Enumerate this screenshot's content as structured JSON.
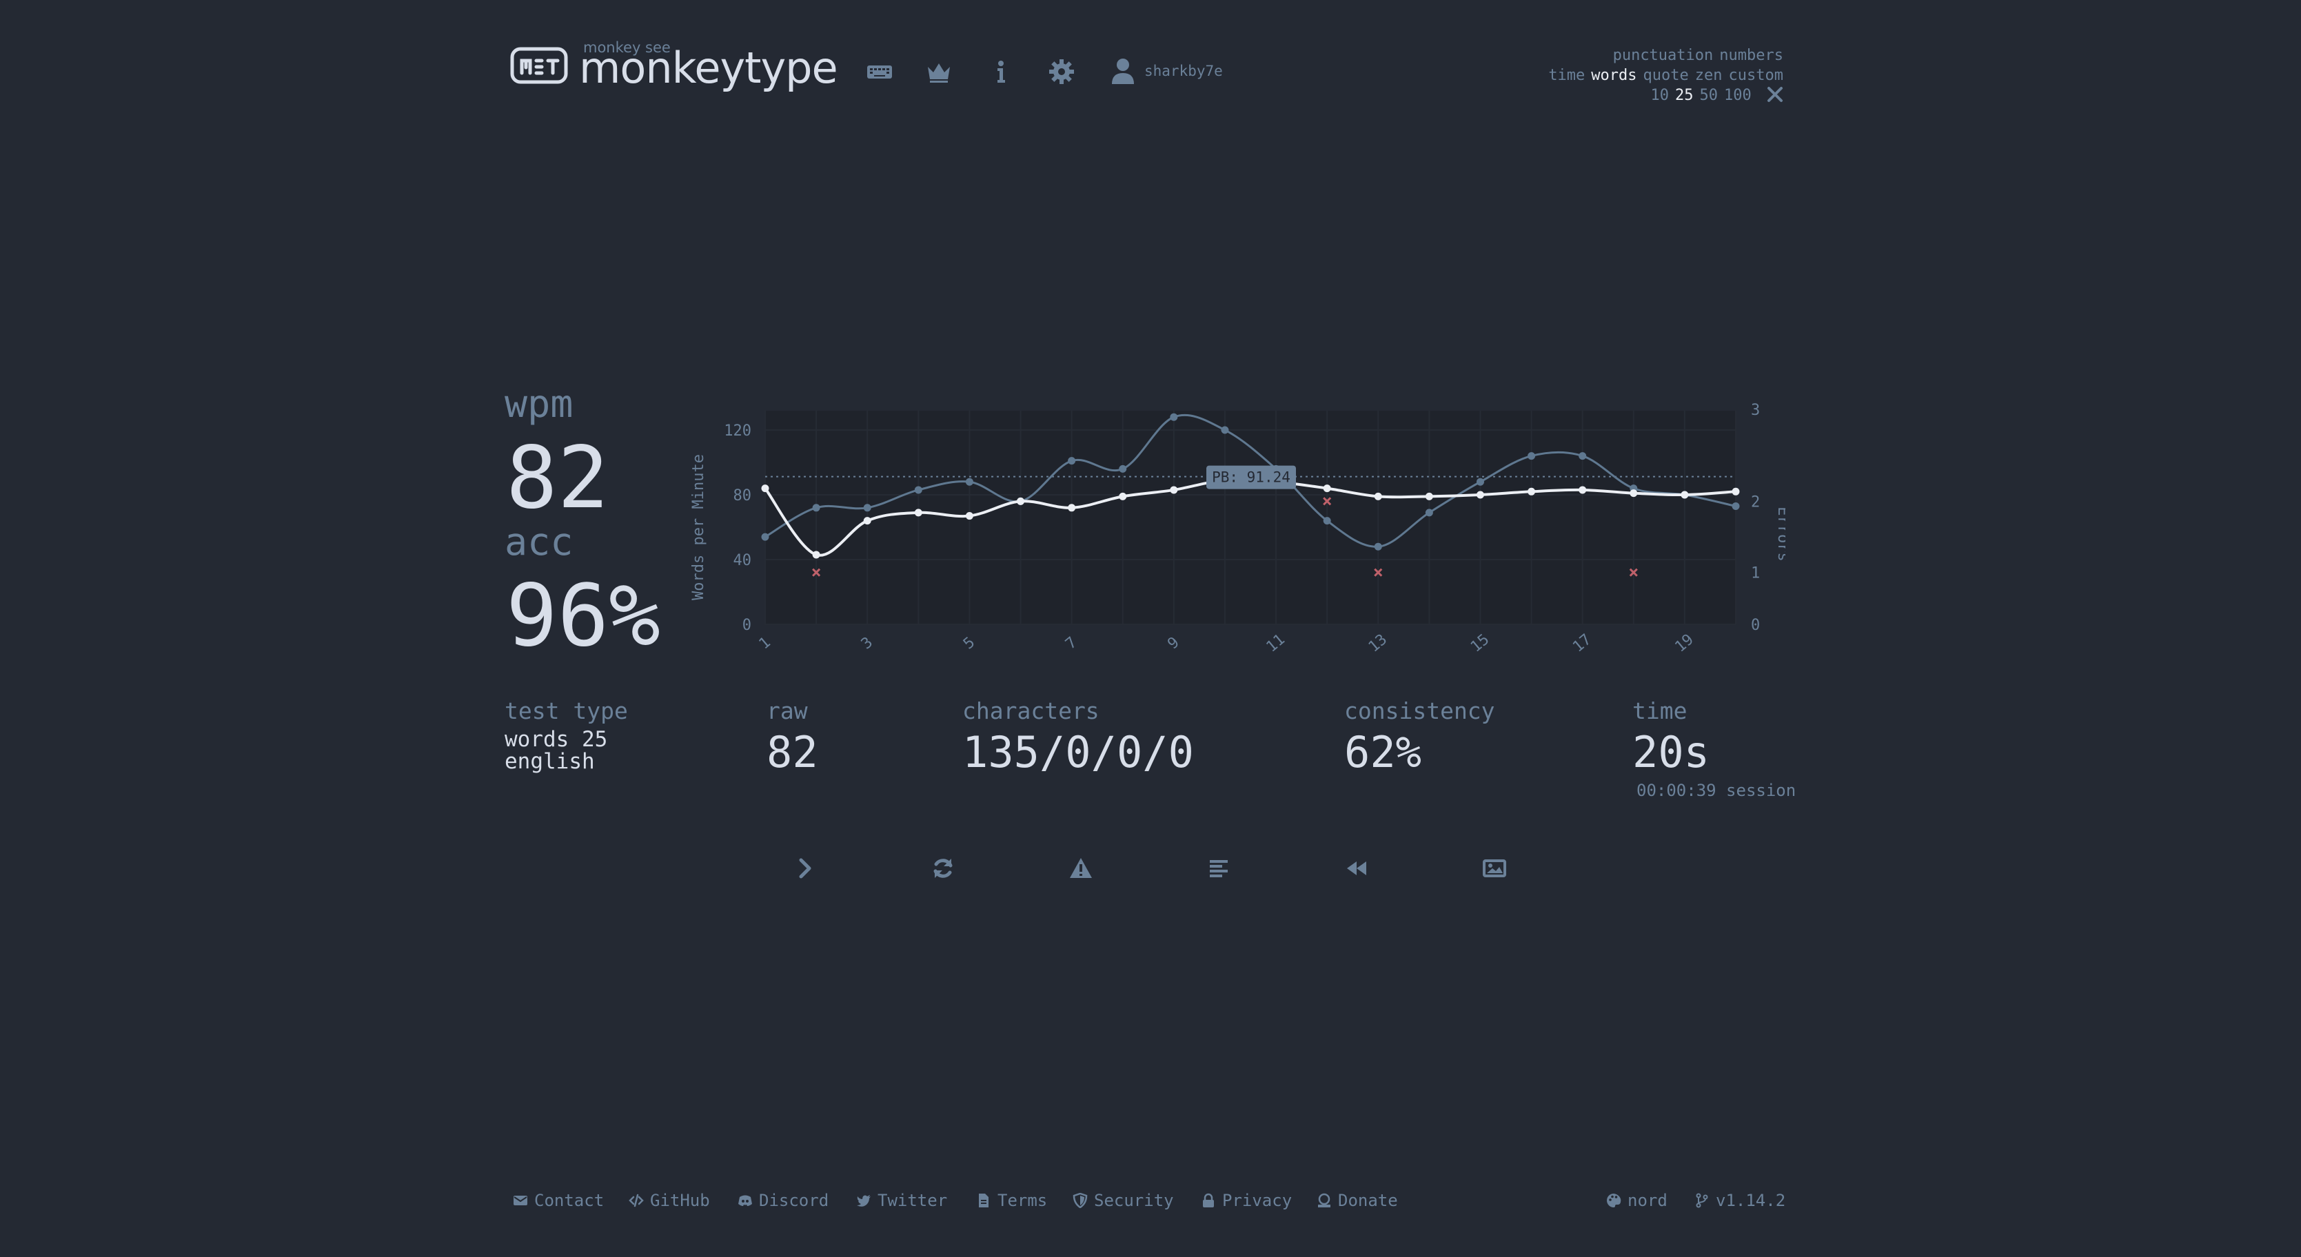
{
  "header": {
    "brand_top": "monkey see",
    "brand_main": "monkeytype",
    "username": "sharkby7e",
    "nav_icons": [
      "keyboard-icon",
      "crown-icon",
      "info-icon",
      "gear-icon",
      "user-icon"
    ]
  },
  "config": {
    "row1": [
      "punctuation",
      "numbers"
    ],
    "row2": [
      "time",
      "words",
      "quote",
      "zen",
      "custom"
    ],
    "row2_active": "words",
    "row3": [
      "10",
      "25",
      "50",
      "100"
    ],
    "row3_active": "25"
  },
  "stats": {
    "wpm_label": "wpm",
    "wpm_value": "82",
    "acc_label": "acc",
    "acc_value": "96%",
    "test_type_label": "test type",
    "test_type_line1": "words 25",
    "test_type_line2": "english",
    "raw_label": "raw",
    "raw_value": "82",
    "characters_label": "characters",
    "characters_value": "135/0/0/0",
    "consistency_label": "consistency",
    "consistency_value": "62%",
    "time_label": "time",
    "time_value": "20s",
    "session_text": "00:00:39 session"
  },
  "chart_data": {
    "type": "line",
    "ylabel": "Words per Minute",
    "y2label": "Errors",
    "ylim": [
      0,
      120
    ],
    "y_ticks": [
      0,
      40,
      80,
      120
    ],
    "y2lim": [
      0,
      3
    ],
    "y2_ticks": [
      0,
      1,
      2,
      3
    ],
    "x_ticks": [
      1,
      3,
      5,
      7,
      9,
      11,
      13,
      15,
      17,
      19
    ],
    "x": [
      1,
      2,
      3,
      4,
      5,
      6,
      7,
      8,
      9,
      10,
      11,
      12,
      13,
      14,
      15,
      16,
      17,
      18,
      19,
      20
    ],
    "pb_label": "PB: 91.24",
    "pb_value": 91.24,
    "series": [
      {
        "values": [
          84,
          43,
          64,
          69,
          67,
          76,
          72,
          79,
          83,
          89,
          88,
          84,
          79,
          79,
          80,
          82,
          83,
          81,
          80,
          82
        ],
        "color": "#eceff4"
      },
      {
        "values": [
          54,
          72,
          72,
          83,
          88,
          76,
          101,
          96,
          128,
          120,
          96,
          64,
          48,
          69,
          88,
          104,
          104,
          84,
          80,
          73
        ],
        "color": "#5f7890"
      }
    ],
    "errors": [
      {
        "x": 2,
        "value": 1
      },
      {
        "x": 12,
        "value": 2
      },
      {
        "x": 13,
        "value": 1
      },
      {
        "x": 18,
        "value": 1
      }
    ],
    "error_color": "#bf616a"
  },
  "actions": [
    "next-test-icon",
    "restart-icon",
    "report-icon",
    "words-history-icon",
    "replay-icon",
    "screenshot-icon"
  ],
  "footer": {
    "links": [
      "Contact",
      "GitHub",
      "Discord",
      "Twitter",
      "Terms",
      "Security",
      "Privacy",
      "Donate"
    ],
    "theme": "nord",
    "version": "v1.14.2"
  }
}
